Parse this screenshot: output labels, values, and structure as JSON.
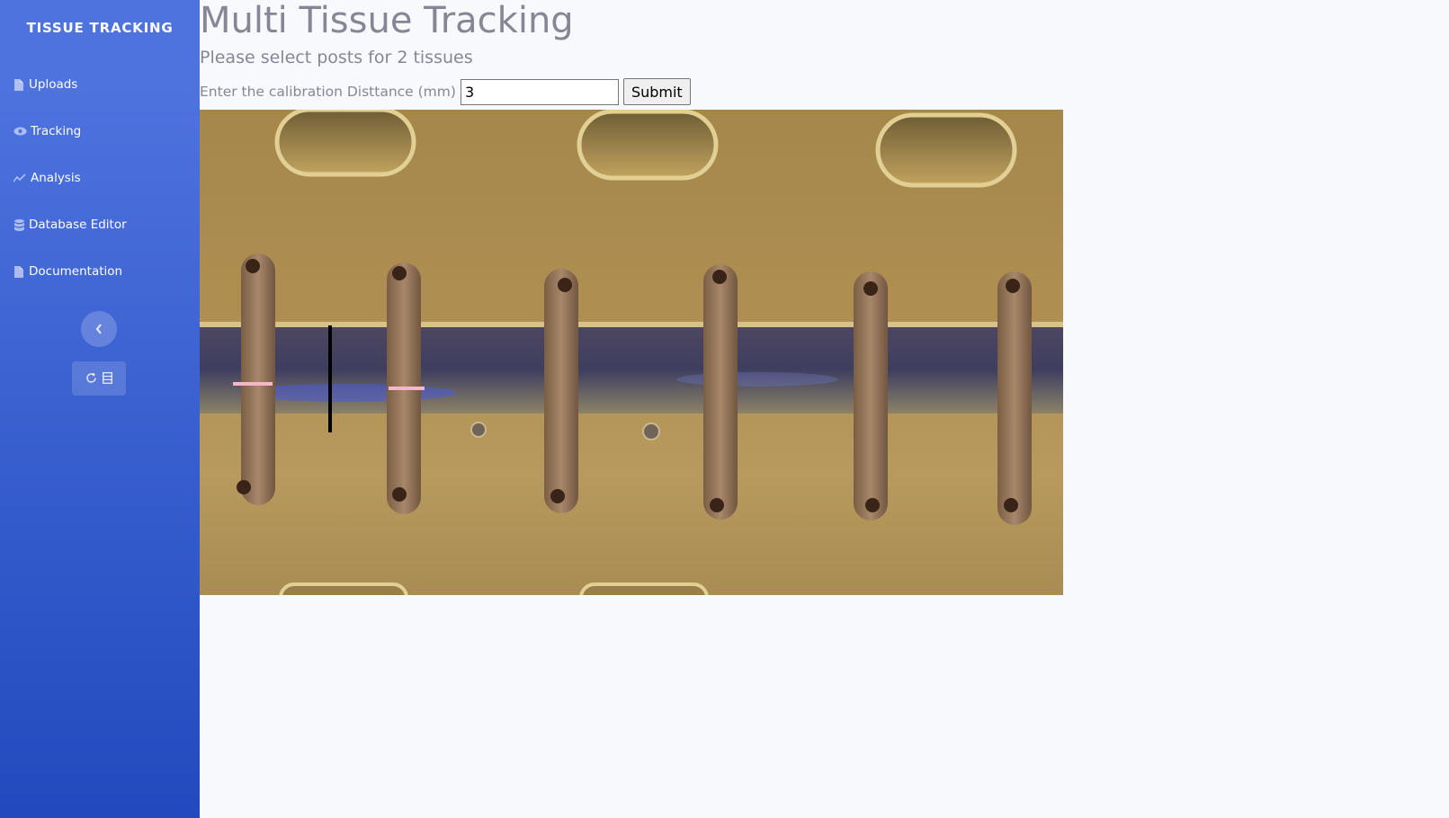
{
  "sidebar": {
    "brand": "TISSUE TRACKING",
    "items": [
      {
        "label": "Uploads",
        "icon": "file-icon"
      },
      {
        "label": "Tracking",
        "icon": "eye-icon"
      },
      {
        "label": "Analysis",
        "icon": "chart-line-icon"
      },
      {
        "label": "Database Editor",
        "icon": "database-icon"
      },
      {
        "label": "Documentation",
        "icon": "file-icon"
      }
    ],
    "toggle_icon": "chevron-left-icon",
    "extra_icons": [
      "refresh-icon",
      "list-icon"
    ]
  },
  "main": {
    "title": "Multi Tissue Tracking",
    "subtitle": "Please select posts for 2 tissues",
    "calibration": {
      "label": "Enter the calibration Disttance (mm)",
      "value": "3",
      "submit_label": "Submit"
    }
  },
  "colors": {
    "sidebar_top": "#4e73df",
    "sidebar_bottom": "#224abe",
    "text": "#858796",
    "background": "#f8f9fc",
    "marker": "#f4b6c8"
  }
}
